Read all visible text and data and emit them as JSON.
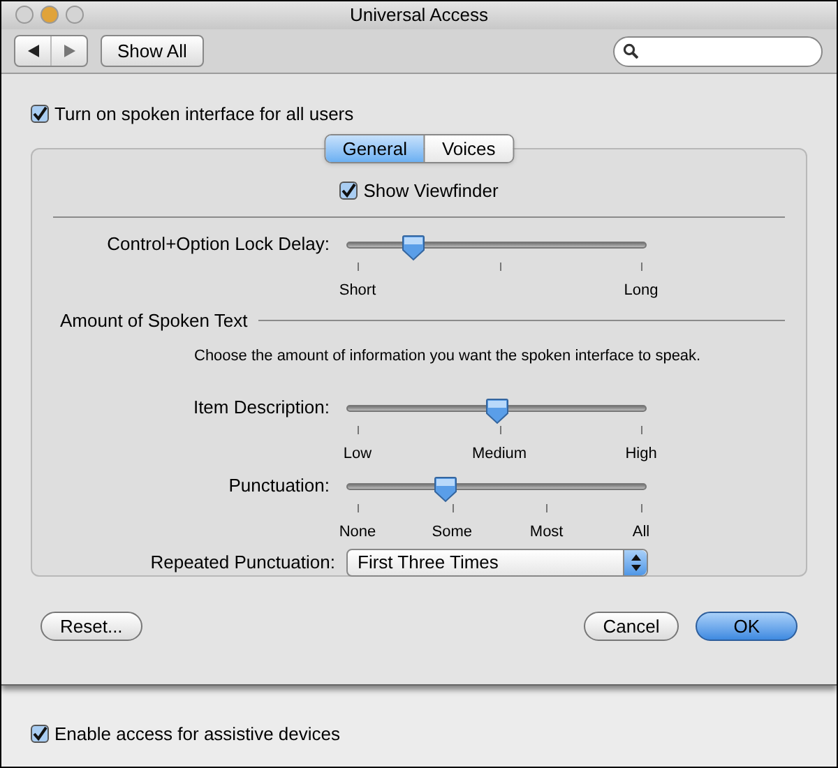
{
  "window": {
    "title": "Universal Access"
  },
  "toolbar": {
    "show_all": "Show All"
  },
  "spoken_interface_checkbox": {
    "label": "Turn on spoken interface for all users",
    "checked": true
  },
  "sheet": {
    "tabs": [
      {
        "label": "General",
        "selected": true
      },
      {
        "label": "Voices",
        "selected": false
      }
    ],
    "show_viewfinder": {
      "label": "Show Viewfinder",
      "checked": true
    },
    "lock_delay": {
      "label": "Control+Option Lock Delay:",
      "level": 0.22,
      "labels": [
        "Short",
        "Long"
      ]
    },
    "section": {
      "title": "Amount of Spoken Text",
      "description": "Choose the amount of information you want the spoken interface to speak."
    },
    "sliders": [
      {
        "label": "Item Description:",
        "level": 0.5,
        "labels": [
          "Low",
          "Medium",
          "High"
        ]
      },
      {
        "label": "Punctuation:",
        "level": 0.33,
        "labels": [
          "None",
          "Some",
          "Most",
          "All"
        ]
      }
    ],
    "repeated_punctuation": {
      "label": "Repeated Punctuation:",
      "value": "First Three Times"
    },
    "buttons": [
      {
        "label": "Reset...",
        "default": false
      },
      {
        "label": "Cancel",
        "default": false
      },
      {
        "label": "OK",
        "default": true
      }
    ]
  },
  "assistive_devices_checkbox": {
    "label": "Enable access for assistive devices",
    "checked": true
  }
}
